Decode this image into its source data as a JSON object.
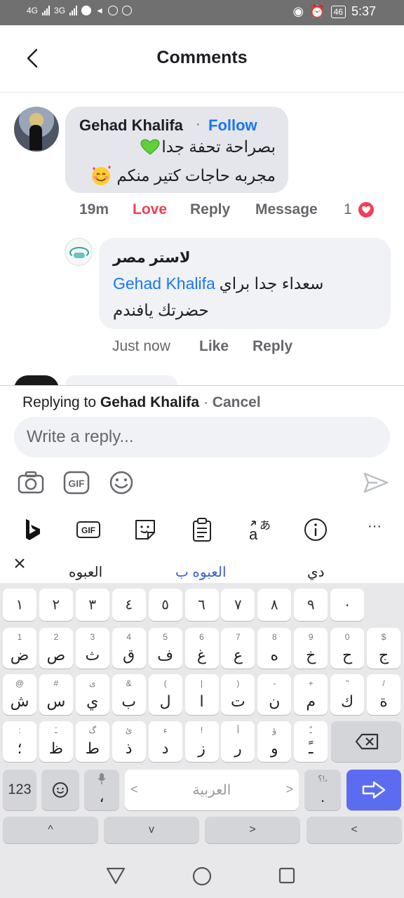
{
  "status_bar": {
    "network1": "4G",
    "network2": "3G",
    "battery": "46",
    "time": "5:37"
  },
  "header": {
    "title": "Comments"
  },
  "comment": {
    "author": "Gehad Khalifa",
    "separator": "·",
    "follow_label": "Follow",
    "line1": "بصراحة تحفة جدا",
    "line2": "مجربه حاجات كتير منكم",
    "time": "19m",
    "love_label": "Love",
    "reply_label": "Reply",
    "message_label": "Message",
    "reaction_count": "1"
  },
  "reply": {
    "author": "لاستر مصر",
    "mention": "Gehad Khalifa",
    "line1_text": "سعداء جدا براي",
    "line2": "حضرتك يافندم",
    "time": "Just now",
    "like_label": "Like",
    "reply_label": "Reply"
  },
  "composer": {
    "replying_prefix": "Replying to",
    "replying_name": "Gehad Khalifa",
    "separator": "·",
    "cancel_label": "Cancel",
    "placeholder": "Write a reply..."
  },
  "keyboard": {
    "toolbar_more": "···",
    "suggestions": [
      "العبوه",
      "العبوه ب",
      "دي"
    ],
    "number_row": [
      "١",
      "٢",
      "٣",
      "٤",
      "٥",
      "٦",
      "٧",
      "٨",
      "٩",
      "٠"
    ],
    "row1": [
      {
        "main": "ض",
        "sub": "1"
      },
      {
        "main": "ص",
        "sub": "2"
      },
      {
        "main": "ث",
        "sub": "3"
      },
      {
        "main": "ق",
        "sub": "4"
      },
      {
        "main": "ف",
        "sub": "5"
      },
      {
        "main": "غ",
        "sub": "6"
      },
      {
        "main": "ع",
        "sub": "7"
      },
      {
        "main": "ه",
        "sub": "8"
      },
      {
        "main": "خ",
        "sub": "9"
      },
      {
        "main": "ح",
        "sub": "0"
      },
      {
        "main": "ج",
        "sub": "$"
      }
    ],
    "row2": [
      {
        "main": "ش",
        "sub": "@"
      },
      {
        "main": "س",
        "sub": "#"
      },
      {
        "main": "ي",
        "sub": "ى"
      },
      {
        "main": "ب",
        "sub": "&"
      },
      {
        "main": "ل",
        "sub": "("
      },
      {
        "main": "ا",
        "sub": "|"
      },
      {
        "main": "ت",
        "sub": ")"
      },
      {
        "main": "ن",
        "sub": "-"
      },
      {
        "main": "م",
        "sub": "+"
      },
      {
        "main": "ك",
        "sub": "\""
      },
      {
        "main": "ة",
        "sub": "/"
      }
    ],
    "row3": [
      {
        "main": "؛",
        "sub": ":"
      },
      {
        "main": "ظ",
        "sub": "ـَ"
      },
      {
        "main": "ط",
        "sub": "گ"
      },
      {
        "main": "ذ",
        "sub": "ئ"
      },
      {
        "main": "د",
        "sub": "ء"
      },
      {
        "main": "ز",
        "sub": "!"
      },
      {
        "main": "ر",
        "sub": "أ"
      },
      {
        "main": "و",
        "sub": "ؤ"
      },
      {
        "main": "ـً",
        "sub": "ـٌ"
      }
    ],
    "key_123": "123",
    "comma": "،",
    "space_label": "العربية",
    "space_left": "<",
    "space_right": ">",
    "period": ".",
    "period_sub": "؟!،",
    "arrows": [
      "^",
      "v",
      ">",
      "<"
    ]
  }
}
